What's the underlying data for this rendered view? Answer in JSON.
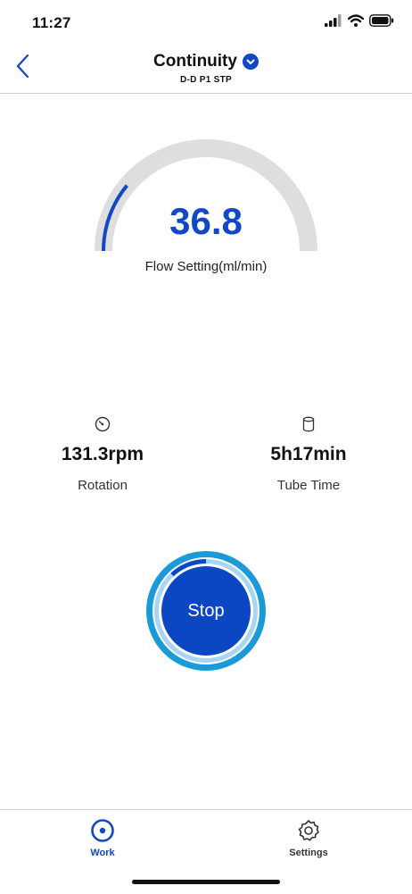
{
  "status_bar": {
    "time": "11:27"
  },
  "header": {
    "title": "Continuity",
    "subtitle": "D-D P1 STP"
  },
  "gauge": {
    "value": "36.8",
    "label": "Flow Setting(ml/min)",
    "level_fraction": 0.22
  },
  "stats": {
    "rotation": {
      "value": "131.3rpm",
      "label": "Rotation",
      "icon": "gauge-icon"
    },
    "tube_time": {
      "value": "5h17min",
      "label": "Tube Time",
      "icon": "cylinder-icon"
    }
  },
  "stop_button": {
    "label": "Stop",
    "progress_fraction": 0.12
  },
  "tab_bar": {
    "tabs": [
      {
        "label": "Work",
        "icon": "work-target-icon",
        "active": true
      },
      {
        "label": "Settings",
        "icon": "settings-gear-icon",
        "active": false
      }
    ]
  },
  "colors": {
    "accent": "#1048c7",
    "gauge_track": "#dedede",
    "ring_outer": "#1a9ad8",
    "ring_light": "#a8d6f2",
    "stop_fill": "#0c47c3"
  }
}
